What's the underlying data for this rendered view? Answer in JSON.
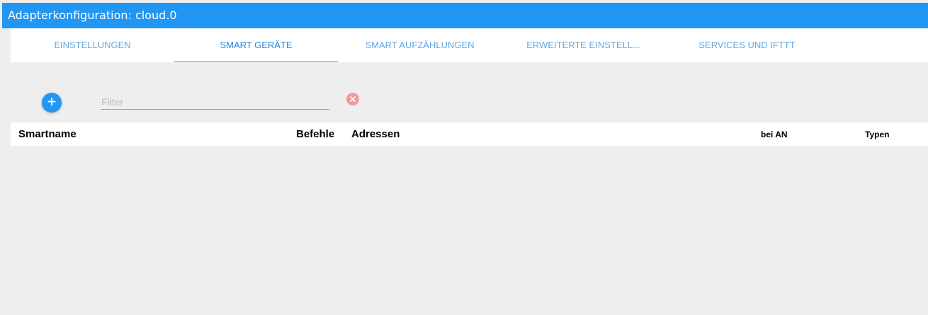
{
  "window": {
    "title": "Adapterkonfiguration: cloud.0"
  },
  "tabs": [
    {
      "label": "EINSTELLUNGEN",
      "active": false
    },
    {
      "label": "SMART GERÄTE",
      "active": true
    },
    {
      "label": "SMART AUFZÄHLUNGEN",
      "active": false
    },
    {
      "label": "ERWEITERTE EINSTELL...",
      "active": false
    },
    {
      "label": "SERVICES UND IFTTT",
      "active": false
    }
  ],
  "toolbar": {
    "add_icon": "plus-icon",
    "add_symbol": "+",
    "filter": {
      "placeholder": "Filter",
      "value": ""
    },
    "clear_icon": "close-icon"
  },
  "table": {
    "columns": [
      "Smartname",
      "Befehle",
      "Adressen",
      "bei AN",
      "Typen"
    ],
    "rows": []
  },
  "colors": {
    "primary": "#2196f3",
    "background": "#eeeeee",
    "tab_text": "#64a7e0",
    "tab_active_text": "#2b86d8",
    "clear_button": "#ef9a9a"
  }
}
